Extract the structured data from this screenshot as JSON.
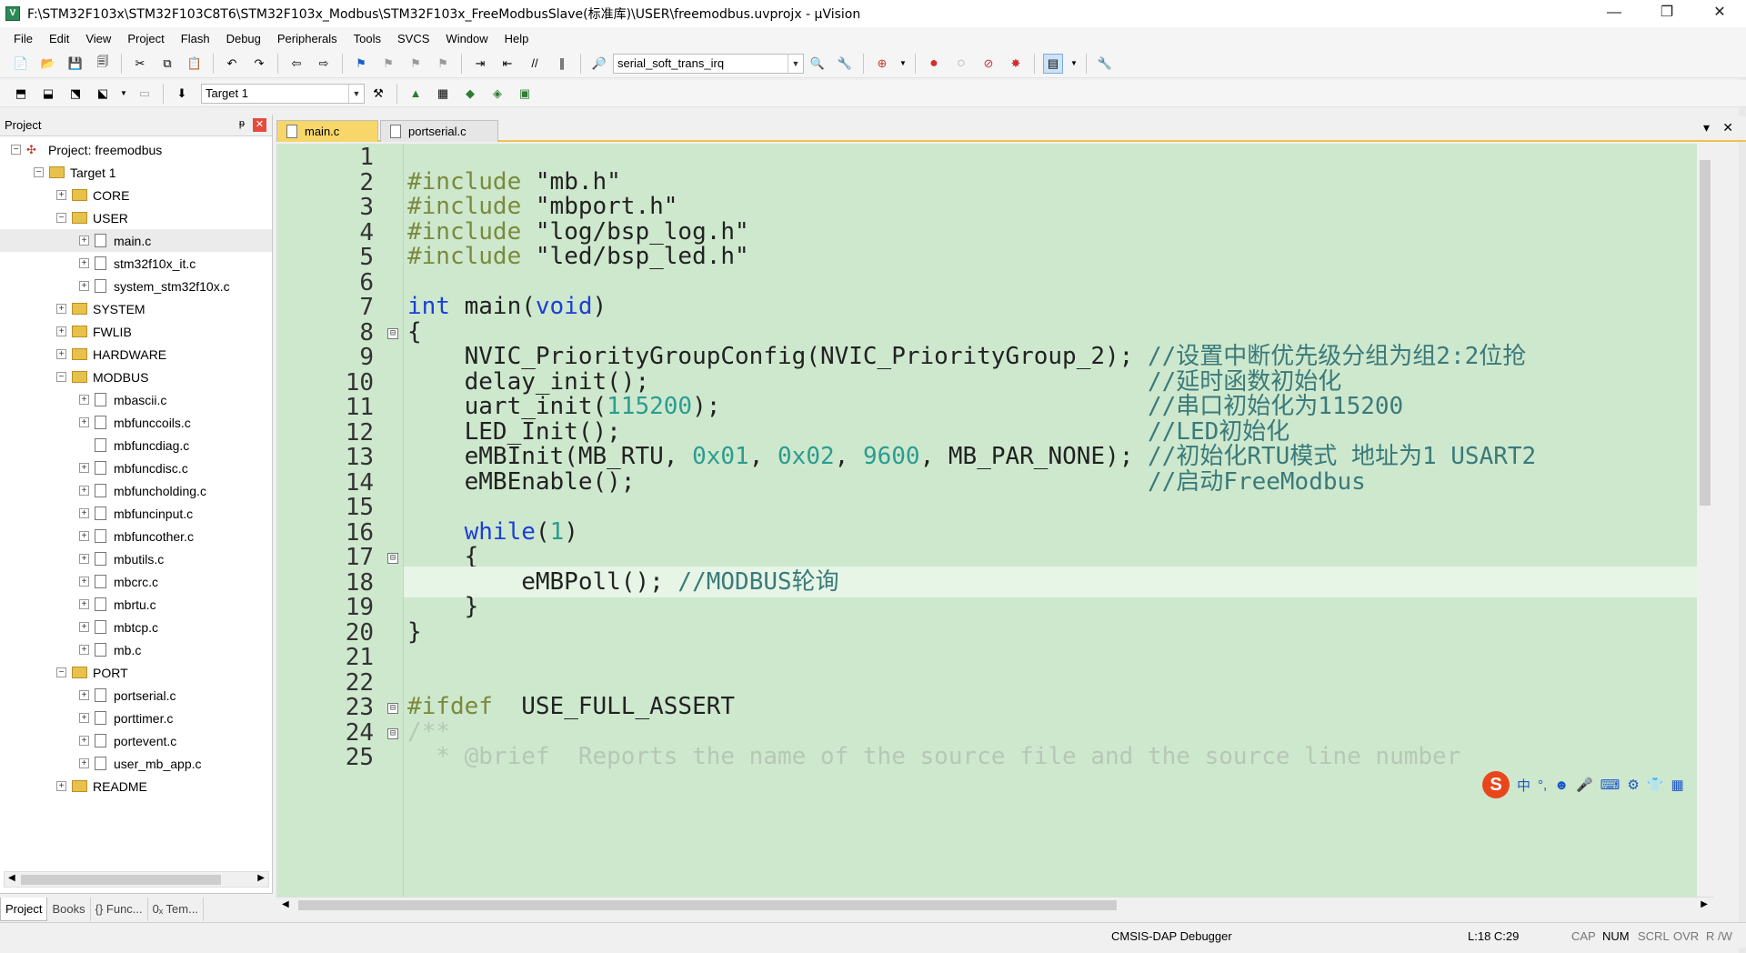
{
  "window": {
    "title": "F:\\STM32F103x\\STM32F103C8T6\\STM32F103x_Modbus\\STM32F103x_FreeModbusSlave(标准库)\\USER\\freemodbus.uvprojx - µVision",
    "minimize": "—",
    "maximize": "❐",
    "close": "✕"
  },
  "menu": [
    "File",
    "Edit",
    "View",
    "Project",
    "Flash",
    "Debug",
    "Peripherals",
    "Tools",
    "SVCS",
    "Window",
    "Help"
  ],
  "toolbar": {
    "target_combo": "serial_soft_trans_irq",
    "build_target": "Target 1"
  },
  "project_panel": {
    "header": "Project",
    "pin": "ᵽ",
    "close": "✕",
    "tree": [
      {
        "label": "Project: freemodbus",
        "level": 0,
        "kind": "project",
        "exp": "−"
      },
      {
        "label": "Target 1",
        "level": 1,
        "kind": "folder",
        "exp": "−"
      },
      {
        "label": "CORE",
        "level": 2,
        "kind": "folder",
        "exp": "+"
      },
      {
        "label": "USER",
        "level": 2,
        "kind": "folder",
        "exp": "−"
      },
      {
        "label": "main.c",
        "level": 3,
        "kind": "file",
        "exp": "+",
        "selected": true
      },
      {
        "label": "stm32f10x_it.c",
        "level": 3,
        "kind": "file",
        "exp": "+"
      },
      {
        "label": "system_stm32f10x.c",
        "level": 3,
        "kind": "file",
        "exp": "+"
      },
      {
        "label": "SYSTEM",
        "level": 2,
        "kind": "folder",
        "exp": "+"
      },
      {
        "label": "FWLIB",
        "level": 2,
        "kind": "folder",
        "exp": "+"
      },
      {
        "label": "HARDWARE",
        "level": 2,
        "kind": "folder",
        "exp": "+"
      },
      {
        "label": "MODBUS",
        "level": 2,
        "kind": "folder",
        "exp": "−"
      },
      {
        "label": "mbascii.c",
        "level": 3,
        "kind": "file",
        "exp": "+"
      },
      {
        "label": "mbfunccoils.c",
        "level": 3,
        "kind": "file",
        "exp": "+"
      },
      {
        "label": "mbfuncdiag.c",
        "level": 3,
        "kind": "file",
        "exp": ""
      },
      {
        "label": "mbfuncdisc.c",
        "level": 3,
        "kind": "file",
        "exp": "+"
      },
      {
        "label": "mbfuncholding.c",
        "level": 3,
        "kind": "file",
        "exp": "+"
      },
      {
        "label": "mbfuncinput.c",
        "level": 3,
        "kind": "file",
        "exp": "+"
      },
      {
        "label": "mbfuncother.c",
        "level": 3,
        "kind": "file",
        "exp": "+"
      },
      {
        "label": "mbutils.c",
        "level": 3,
        "kind": "file",
        "exp": "+"
      },
      {
        "label": "mbcrc.c",
        "level": 3,
        "kind": "file",
        "exp": "+"
      },
      {
        "label": "mbrtu.c",
        "level": 3,
        "kind": "file",
        "exp": "+"
      },
      {
        "label": "mbtcp.c",
        "level": 3,
        "kind": "file",
        "exp": "+"
      },
      {
        "label": "mb.c",
        "level": 3,
        "kind": "file",
        "exp": "+"
      },
      {
        "label": "PORT",
        "level": 2,
        "kind": "folder",
        "exp": "−"
      },
      {
        "label": "portserial.c",
        "level": 3,
        "kind": "file",
        "exp": "+"
      },
      {
        "label": "porttimer.c",
        "level": 3,
        "kind": "file",
        "exp": "+"
      },
      {
        "label": "portevent.c",
        "level": 3,
        "kind": "file",
        "exp": "+"
      },
      {
        "label": "user_mb_app.c",
        "level": 3,
        "kind": "file",
        "exp": "+"
      },
      {
        "label": "README",
        "level": 2,
        "kind": "folder",
        "exp": "+"
      }
    ],
    "bottom_tabs": [
      "Project",
      "Books",
      "{} Func...",
      "0ₓ Tem..."
    ]
  },
  "editor": {
    "tabs": [
      {
        "label": "main.c",
        "active": true
      },
      {
        "label": "portserial.c",
        "active": false
      }
    ],
    "dropdown": "▾",
    "close": "✕",
    "lines": [
      {
        "n": "1",
        "fold": "",
        "tokens": []
      },
      {
        "n": "2",
        "fold": "",
        "tokens": [
          {
            "t": "#include ",
            "c": "pp"
          },
          {
            "t": "\"mb.h\"",
            "c": "str"
          }
        ]
      },
      {
        "n": "3",
        "fold": "",
        "tokens": [
          {
            "t": "#include ",
            "c": "pp"
          },
          {
            "t": "\"mbport.h\"",
            "c": "str"
          }
        ]
      },
      {
        "n": "4",
        "fold": "",
        "tokens": [
          {
            "t": "#include ",
            "c": "pp"
          },
          {
            "t": "\"log/bsp_log.h\"",
            "c": "str"
          }
        ]
      },
      {
        "n": "5",
        "fold": "",
        "tokens": [
          {
            "t": "#include ",
            "c": "pp"
          },
          {
            "t": "\"led/bsp_led.h\"",
            "c": "str"
          }
        ]
      },
      {
        "n": "6",
        "fold": "",
        "tokens": []
      },
      {
        "n": "7",
        "fold": "",
        "tokens": [
          {
            "t": "int",
            "c": "kw"
          },
          {
            "t": " main(",
            "c": "id"
          },
          {
            "t": "void",
            "c": "kw"
          },
          {
            "t": ")",
            "c": "id"
          }
        ]
      },
      {
        "n": "8",
        "fold": "⊟",
        "tokens": [
          {
            "t": "{",
            "c": "id"
          }
        ]
      },
      {
        "n": "9",
        "fold": "",
        "tokens": [
          {
            "t": "    NVIC_PriorityGroupConfig(NVIC_PriorityGroup_2); ",
            "c": "id"
          },
          {
            "t": "//设置中断优先级分组为组2:2位抢",
            "c": "cm"
          }
        ]
      },
      {
        "n": "10",
        "fold": "",
        "tokens": [
          {
            "t": "    delay_init();                                   ",
            "c": "id"
          },
          {
            "t": "//延时函数初始化",
            "c": "cm"
          }
        ]
      },
      {
        "n": "11",
        "fold": "",
        "tokens": [
          {
            "t": "    uart_init(",
            "c": "id"
          },
          {
            "t": "115200",
            "c": "num"
          },
          {
            "t": ");                              ",
            "c": "id"
          },
          {
            "t": "//串口初始化为115200",
            "c": "cm"
          }
        ]
      },
      {
        "n": "12",
        "fold": "",
        "tokens": [
          {
            "t": "    LED_Init();                                     ",
            "c": "id"
          },
          {
            "t": "//LED初始化",
            "c": "cm"
          }
        ]
      },
      {
        "n": "13",
        "fold": "",
        "tokens": [
          {
            "t": "    eMBInit(MB_RTU, ",
            "c": "id"
          },
          {
            "t": "0x01",
            "c": "num"
          },
          {
            "t": ", ",
            "c": "id"
          },
          {
            "t": "0x02",
            "c": "num"
          },
          {
            "t": ", ",
            "c": "id"
          },
          {
            "t": "9600",
            "c": "num"
          },
          {
            "t": ", MB_PAR_NONE); ",
            "c": "id"
          },
          {
            "t": "//初始化RTU模式 地址为1 USART2",
            "c": "cm"
          }
        ]
      },
      {
        "n": "14",
        "fold": "",
        "tokens": [
          {
            "t": "    eMBEnable();                                    ",
            "c": "id"
          },
          {
            "t": "//启动FreeModbus",
            "c": "cm"
          }
        ]
      },
      {
        "n": "15",
        "fold": "",
        "tokens": []
      },
      {
        "n": "16",
        "fold": "",
        "tokens": [
          {
            "t": "    ",
            "c": "id"
          },
          {
            "t": "while",
            "c": "kw"
          },
          {
            "t": "(",
            "c": "id"
          },
          {
            "t": "1",
            "c": "num"
          },
          {
            "t": ")",
            "c": "id"
          }
        ]
      },
      {
        "n": "17",
        "fold": "⊟",
        "tokens": [
          {
            "t": "    {",
            "c": "id"
          }
        ]
      },
      {
        "n": "18",
        "fold": "",
        "current": true,
        "tokens": [
          {
            "t": "        eMBPoll(); ",
            "c": "id"
          },
          {
            "t": "//MODBUS轮询",
            "c": "cm"
          }
        ]
      },
      {
        "n": "19",
        "fold": "",
        "tokens": [
          {
            "t": "    }",
            "c": "id"
          }
        ]
      },
      {
        "n": "20",
        "fold": "",
        "tokens": [
          {
            "t": "}",
            "c": "id"
          }
        ]
      },
      {
        "n": "21",
        "fold": "",
        "tokens": []
      },
      {
        "n": "22",
        "fold": "",
        "tokens": []
      },
      {
        "n": "23",
        "fold": "⊟",
        "tokens": [
          {
            "t": "#ifdef  ",
            "c": "pp"
          },
          {
            "t": "USE_FULL_ASSERT",
            "c": "id"
          }
        ]
      },
      {
        "n": "24",
        "fold": "⊟",
        "tokens": [
          {
            "t": "/**",
            "c": "faded"
          }
        ]
      },
      {
        "n": "25",
        "fold": "",
        "tokens": [
          {
            "t": "  * @brief  Reports the name of the source file and the source line number",
            "c": "faded"
          }
        ]
      }
    ]
  },
  "ime": {
    "logo": "S",
    "items": [
      "中",
      "°,",
      "☻",
      "🎤",
      "⌨",
      "⚙",
      "👕",
      "▦"
    ]
  },
  "status": {
    "debugger": "CMSIS-DAP Debugger",
    "position": "L:18 C:29",
    "cap": "CAP",
    "num": "NUM",
    "scrl": "SCRL",
    "ovr": "OVR",
    "rw": "R /W"
  }
}
